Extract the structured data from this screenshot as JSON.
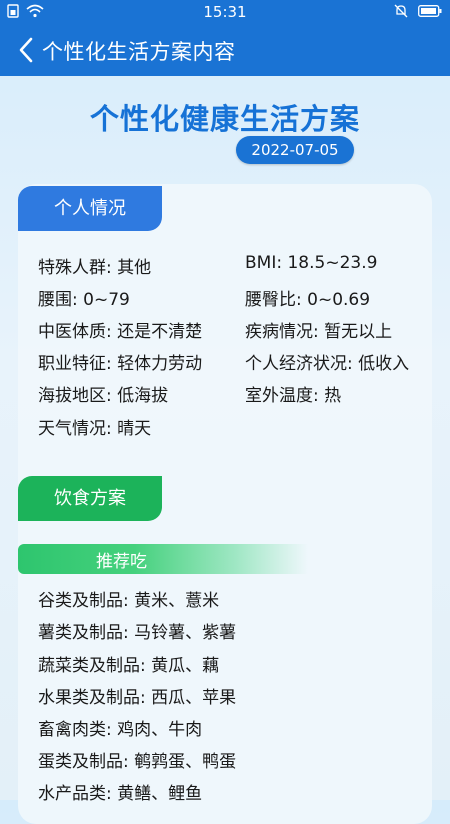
{
  "status_bar": {
    "time": "15:31"
  },
  "header": {
    "title": "个性化生活方案内容"
  },
  "plan": {
    "title": "个性化健康生活方案",
    "date": "2022-07-05"
  },
  "personal": {
    "tab_label": "个人情况",
    "left": [
      "特殊人群: 其他",
      "腰围: 0~79",
      "中医体质: 还是不清楚",
      "职业特征: 轻体力劳动",
      "海拔地区: 低海拔",
      "天气情况: 晴天"
    ],
    "right": [
      "BMI: 18.5~23.9",
      "腰臀比: 0~0.69",
      "疾病情况: 暂无以上",
      "个人经济状况: 低收入",
      "室外温度: 热"
    ]
  },
  "diet": {
    "tab_label": "饮食方案",
    "recommend_label": "推荐吃",
    "items": [
      "谷类及制品: 黄米、薏米",
      "薯类及制品: 马铃薯、紫薯",
      "蔬菜类及制品: 黄瓜、藕",
      "水果类及制品: 西瓜、苹果",
      "畜禽肉类: 鸡肉、牛肉",
      "蛋类及制品: 鹌鹑蛋、鸭蛋",
      "水产品类: 黄鳝、鲤鱼"
    ]
  },
  "icons": {
    "back": "chevron-left-icon",
    "wifi": "wifi-icon",
    "sim": "sim-icon",
    "alarm": "bell-off-icon",
    "battery": "battery-icon"
  },
  "colors": {
    "primary": "#1a73d4",
    "green": "#1cb35a",
    "title": "#1672d6"
  }
}
